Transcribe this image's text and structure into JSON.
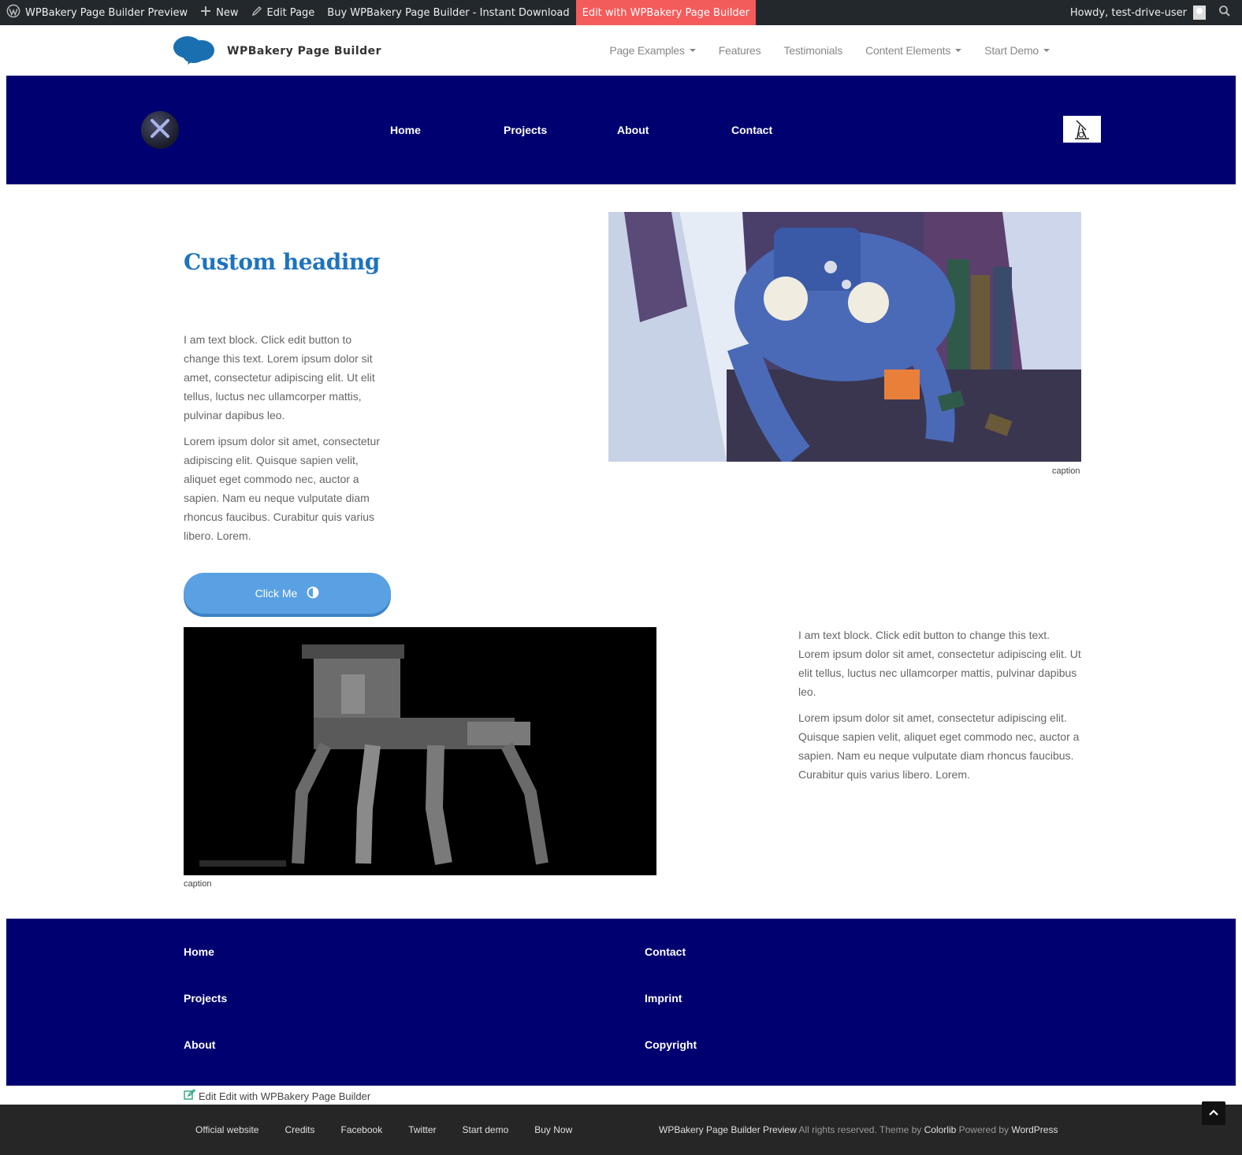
{
  "admin_bar": {
    "site_name": "WPBakery Page Builder Preview",
    "new_label": "New",
    "edit_page_label": "Edit Page",
    "buy_label": "Buy WPBakery Page Builder - Instant Download",
    "edit_vc_label": "Edit with WPBakery Page Builder",
    "howdy_label": "Howdy, test-drive-user",
    "accent_color": "#f45b5b"
  },
  "header": {
    "logo_text": "WPBakery Page Builder",
    "nav": [
      {
        "label": "Page Examples",
        "dropdown": true
      },
      {
        "label": "Features",
        "dropdown": false
      },
      {
        "label": "Testimonials",
        "dropdown": false
      },
      {
        "label": "Content Elements",
        "dropdown": true
      },
      {
        "label": "Start Demo",
        "dropdown": true
      }
    ]
  },
  "nav_band": {
    "links": [
      "Home",
      "Projects",
      "About",
      "Contact"
    ],
    "background_color": "#000070"
  },
  "content": {
    "heading": "Custom heading",
    "text_block_1": {
      "p1": "I am text block. Click edit button to change this text. Lorem ipsum dolor sit amet, consectetur adipiscing elit. Ut elit tellus, luctus nec ullamcorper mattis, pulvinar dapibus leo.",
      "p2": "Lorem ipsum dolor sit amet, consectetur adipiscing elit. Quisque sapien velit, aliquet eget commodo nec, auctor a sapien. Nam eu neque vulputate diam rhoncus faucibus. Curabitur quis varius libero. Lorem."
    },
    "image_1_caption": "caption",
    "button_label": "Click Me",
    "image_2_caption": "caption",
    "text_block_2": {
      "p1": "I am text block. Click edit button to change this text. Lorem ipsum dolor sit amet, consectetur adipiscing elit. Ut elit tellus, luctus nec ullamcorper mattis, pulvinar dapibus leo.",
      "p2": "Lorem ipsum dolor sit amet, consectetur adipiscing elit. Quisque sapien velit, aliquet eget commodo nec, auctor a sapien. Nam eu neque vulputate diam rhoncus faucibus. Curabitur quis varius libero. Lorem."
    }
  },
  "footer_band": {
    "col1": [
      "Home",
      "Projects",
      "About"
    ],
    "col2": [
      "Contact",
      "Imprint",
      "Copyright"
    ]
  },
  "edit_link": "Edit Edit with WPBakery Page Builder",
  "bottom_bar": {
    "links": [
      "Official website",
      "Credits",
      "Facebook",
      "Twitter",
      "Start demo",
      "Buy Now"
    ],
    "credit_site": "WPBakery Page Builder Preview",
    "credit_rights": " All rights reserved. Theme by ",
    "credit_theme": "Colorlib",
    "credit_powered": " Powered by ",
    "credit_wp": "WordPress"
  },
  "icons": {
    "wp_logo": "wordpress-icon",
    "new": "plus-icon",
    "edit": "pencil-icon",
    "search": "search-icon",
    "close": "close-icon",
    "contrast": "half-circle-icon",
    "edit_doc": "edit-icon",
    "to_top": "chevron-up-icon"
  }
}
